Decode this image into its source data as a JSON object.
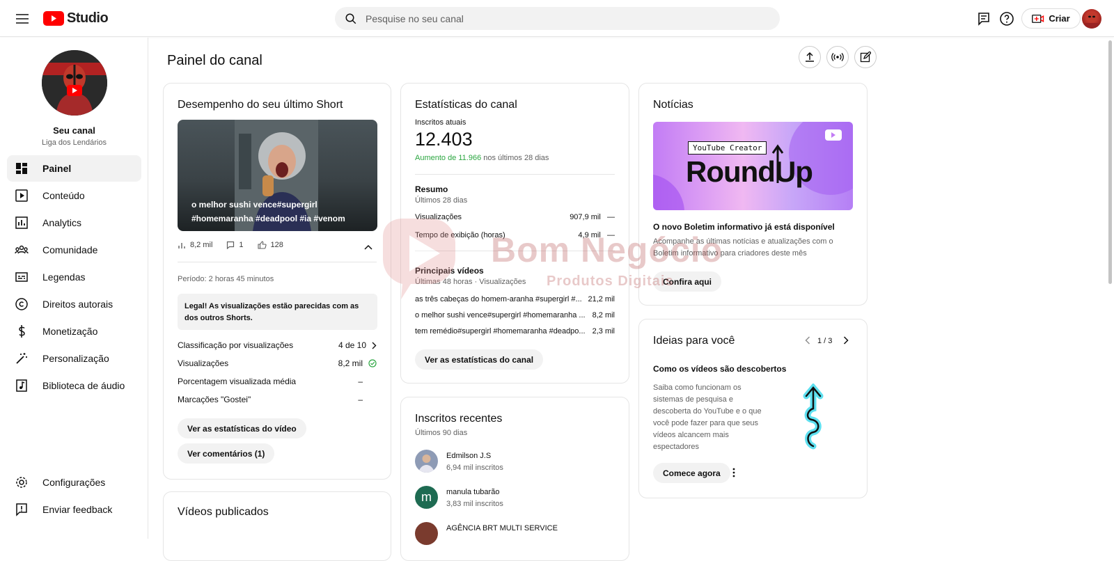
{
  "app": {
    "logo_text": "Studio",
    "brand_color": "#ff0000"
  },
  "search": {
    "placeholder": "Pesquise no seu canal"
  },
  "header": {
    "create_label": "Criar"
  },
  "channel": {
    "name": "Seu canal",
    "handle": "Liga dos Lendários"
  },
  "sidebar": {
    "items": [
      {
        "label": "Painel",
        "icon": "dashboard-icon",
        "active": true
      },
      {
        "label": "Conteúdo",
        "icon": "content-icon"
      },
      {
        "label": "Analytics",
        "icon": "analytics-icon"
      },
      {
        "label": "Comunidade",
        "icon": "community-icon"
      },
      {
        "label": "Legendas",
        "icon": "subtitles-icon"
      },
      {
        "label": "Direitos autorais",
        "icon": "copyright-icon"
      },
      {
        "label": "Monetização",
        "icon": "money-icon"
      },
      {
        "label": "Personalização",
        "icon": "magic-wand-icon"
      },
      {
        "label": "Biblioteca de áudio",
        "icon": "audio-library-icon"
      }
    ],
    "bottom": [
      {
        "label": "Configurações",
        "icon": "gear-icon"
      },
      {
        "label": "Enviar feedback",
        "icon": "feedback-icon"
      }
    ]
  },
  "page": {
    "title": "Painel do canal"
  },
  "short_card": {
    "title": "Desempenho do seu último Short",
    "thumb_caption": "o melhor sushi vence#supergirl #homemaranha #deadpool #ia #venom",
    "views": "8,2 mil",
    "comments": "1",
    "likes": "128",
    "period": "Período: 2 horas 45 minutos",
    "notice": "Legal! As visualizações estão parecidas com as dos outros Shorts.",
    "metrics": [
      {
        "label": "Classificação por visualizações",
        "value": "4 de 10"
      },
      {
        "label": "Visualizações",
        "value": "8,2 mil"
      },
      {
        "label": "Porcentagem visualizada média",
        "value": "–"
      },
      {
        "label": "Marcações \"Gostei\"",
        "value": "–"
      }
    ],
    "btn_stats": "Ver as estatísticas do vídeo",
    "btn_comments": "Ver comentários (1)"
  },
  "videos_card": {
    "title": "Vídeos publicados"
  },
  "stats_card": {
    "title": "Estatísticas do canal",
    "subs_label": "Inscritos atuais",
    "subs_value": "12.403",
    "growth_value": "Aumento de 11.966",
    "growth_suffix": " nos últimos 28 dias",
    "summary_title": "Resumo",
    "summary_period": "Últimos 28 dias",
    "summary": [
      {
        "label": "Visualizações",
        "value": "907,9 mil",
        "trend": "—"
      },
      {
        "label": "Tempo de exibição (horas)",
        "value": "4,9 mil",
        "trend": "—"
      }
    ],
    "top_title": "Principais vídeos",
    "top_period": "Últimas 48 horas · Visualizações",
    "top_videos": [
      {
        "title": "as três cabeças do homem-aranha #supergirl #...",
        "views": "21,2 mil"
      },
      {
        "title": "o melhor sushi vence#supergirl #homemaranha ...",
        "views": "8,2 mil"
      },
      {
        "title": "tem remédio#supergirl #homemaranha #deadpo...",
        "views": "2,3 mil"
      }
    ],
    "btn": "Ver as estatísticas do canal"
  },
  "recent_subs": {
    "title": "Inscritos recentes",
    "period": "Últimos 90 dias",
    "items": [
      {
        "name": "Edmilson J.S",
        "subs": "6,94 mil inscritos",
        "initial": "",
        "color": "#8e9bb5"
      },
      {
        "name": "manula tubarão",
        "subs": "3,83 mil inscritos",
        "initial": "m",
        "color": "#1e6b52"
      },
      {
        "name": "AGÊNCIA BRT MULTI SERVICE",
        "subs": "",
        "initial": "",
        "color": "#7a3b2e"
      }
    ]
  },
  "news_card": {
    "title": "Notícias",
    "banner_tag": "YouTube Creator",
    "banner_title": "RoundUp",
    "headline": "O novo Boletim informativo já está disponível",
    "body": "Acompanhe as últimas notícias e atualizações com o Boletim informativo para criadores deste mês",
    "btn": "Confira aqui"
  },
  "ideas_card": {
    "title": "Ideias para você",
    "pager": "1 / 3",
    "headline": "Como os vídeos são descobertos",
    "body": "Saiba como funcionam os sistemas de pesquisa e descoberta do YouTube e o que você pode fazer para que seus vídeos alcancem mais espectadores",
    "btn": "Comece agora"
  },
  "watermark": {
    "title": "Bom Negócio",
    "subtitle": "Produtos Digitais"
  }
}
